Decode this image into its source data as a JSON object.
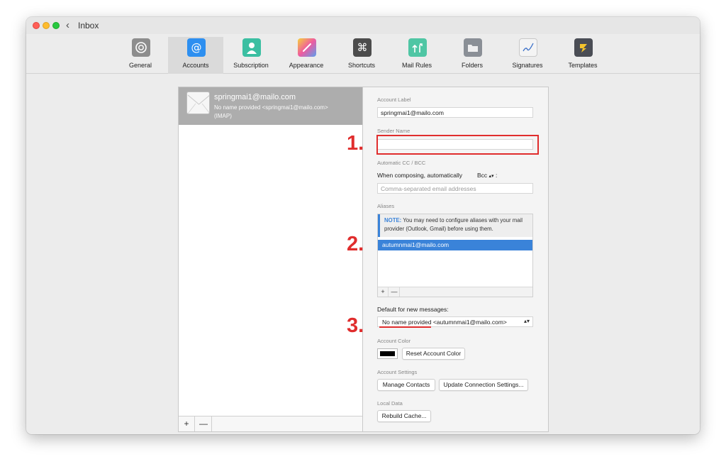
{
  "window": {
    "title": "Inbox"
  },
  "toolbar": {
    "items": [
      {
        "label": "General",
        "icon": "gear-icon"
      },
      {
        "label": "Accounts",
        "icon": "at-icon"
      },
      {
        "label": "Subscription",
        "icon": "person-icon"
      },
      {
        "label": "Appearance",
        "icon": "brush-icon"
      },
      {
        "label": "Shortcuts",
        "icon": "command-icon"
      },
      {
        "label": "Mail Rules",
        "icon": "rules-arrows-icon"
      },
      {
        "label": "Folders",
        "icon": "folder-icon"
      },
      {
        "label": "Signatures",
        "icon": "signature-pen-icon"
      },
      {
        "label": "Templates",
        "icon": "template-icon"
      }
    ],
    "active": "Accounts"
  },
  "accounts": {
    "selected": {
      "email": "springmai1@mailo.com",
      "display": "No name provided <springmai1@mailo.com>",
      "type": "(IMAP)"
    },
    "add_label": "+",
    "remove_label": "—"
  },
  "settings": {
    "account_label": {
      "title": "Account Label",
      "value": "springmai1@mailo.com"
    },
    "sender_name": {
      "title": "Sender Name",
      "value": ""
    },
    "auto_cc": {
      "title": "Automatic CC / BCC",
      "prompt": "When composing, automatically",
      "mode": "Bcc",
      "suffix": ":",
      "placeholder": "Comma-separated email addresses"
    },
    "aliases": {
      "title": "Aliases",
      "note_bold": "NOTE:",
      "note_text": "You may need to configure aliases with your mail provider (Outlook, Gmail) before using them.",
      "items": [
        "autumnmai1@mailo.com"
      ],
      "add_label": "+",
      "remove_label": "—"
    },
    "default_sender": {
      "title": "Default for new messages:",
      "value": "No name provided <autumnmai1@mailo.com>"
    },
    "account_color": {
      "title": "Account Color",
      "color": "#000000",
      "reset_label": "Reset Account Color"
    },
    "account_settings": {
      "title": "Account Settings",
      "manage_contacts": "Manage Contacts",
      "update_connection": "Update Connection Settings..."
    },
    "local_data": {
      "title": "Local Data",
      "rebuild_cache": "Rebuild Cache..."
    }
  },
  "annotations": {
    "one": "1.",
    "two": "2.",
    "three": "3.",
    "color": "#e02d2d"
  }
}
